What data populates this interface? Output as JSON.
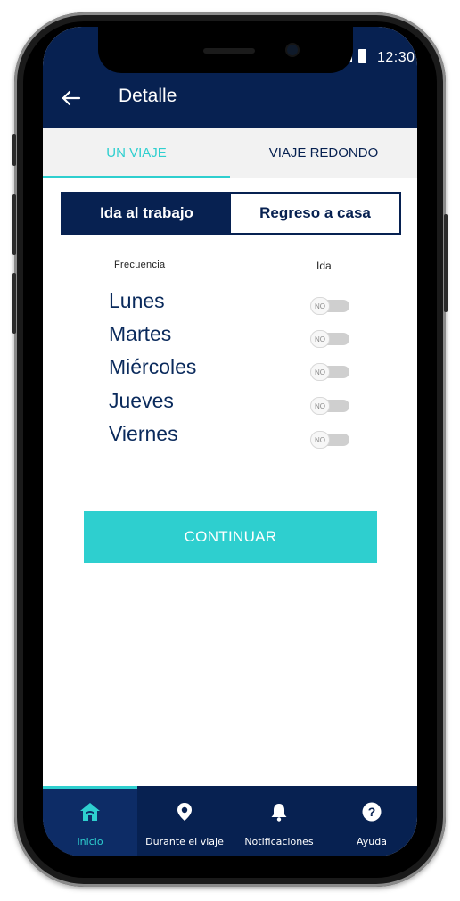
{
  "status_bar": {
    "time": "12:30"
  },
  "app_bar": {
    "title": "Detalle"
  },
  "tabs": [
    {
      "label": "UN VIAJE",
      "active": true
    },
    {
      "label": "VIAJE REDONDO",
      "active": false
    }
  ],
  "segmented": {
    "options": [
      {
        "label": "Ida al trabajo",
        "active": true
      },
      {
        "label": "Regreso a casa",
        "active": false
      }
    ]
  },
  "schedule": {
    "frequency_label": "Frecuencia",
    "column_label": "Ida",
    "days": [
      {
        "name": "Lunes",
        "toggle": "NO"
      },
      {
        "name": "Martes",
        "toggle": "NO"
      },
      {
        "name": "Miércoles",
        "toggle": "NO"
      },
      {
        "name": "Jueves",
        "toggle": "NO"
      },
      {
        "name": "Viernes",
        "toggle": "NO"
      }
    ]
  },
  "continue_label": "CONTINUAR",
  "bottom_nav": [
    {
      "label": "Inicio",
      "icon": "home-icon",
      "active": true
    },
    {
      "label": "Durante el viaje",
      "icon": "location-pin-icon",
      "active": false
    },
    {
      "label": "Notificaciones",
      "icon": "bell-icon",
      "active": false
    },
    {
      "label": "Ayuda",
      "icon": "help-icon",
      "active": false
    }
  ],
  "colors": {
    "primary": "#072151",
    "accent": "#2ecfcf"
  }
}
